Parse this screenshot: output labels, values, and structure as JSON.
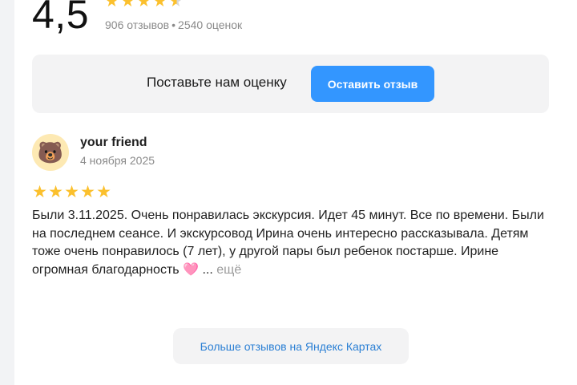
{
  "summary": {
    "rating_value": "4,5",
    "stars_full": 4,
    "stars_half": 1,
    "reviews_count": "906 отзывов",
    "separator": "•",
    "ratings_count": "2540 оценок"
  },
  "cta": {
    "prompt": "Поставьте нам оценку",
    "button_label": "Оставить отзыв"
  },
  "review": {
    "avatar_emoji": "🐻",
    "author": "your friend",
    "date": "4 ноября 2025",
    "stars": 5,
    "text": "Были 3.11.2025. Очень понравилась экскурсия. Идет 45 минут. Все по времени. Были на последнем сеансе. И экскурсовод Ирина очень интересно рассказывала. Детям тоже очень понравилось (7 лет), у другой пары был ребенок постарше. Ирине огромная благодарность",
    "emoji": "🩷",
    "ellipsis": "...",
    "more_label": "ещё"
  },
  "footer": {
    "more_reviews_label": "Больше отзывов на Яндекс Картах"
  },
  "colors": {
    "star": "#fbc02d",
    "accent_button": "#3396ff",
    "link": "#2a7fd4",
    "muted": "#8a8a8a"
  }
}
